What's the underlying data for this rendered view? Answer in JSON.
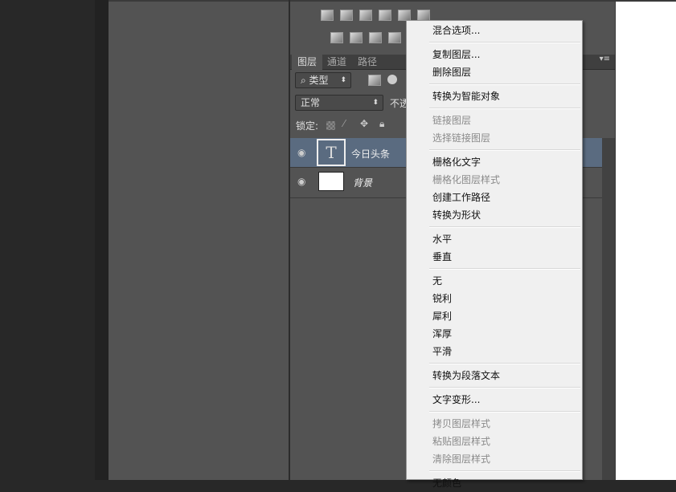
{
  "layers_panel": {
    "tabs": [
      "图层",
      "通道",
      "路径"
    ],
    "filter_kind": "类型",
    "blend_mode": "正常",
    "opacity_label": "不透",
    "lock_label": "锁定:",
    "layers": [
      {
        "name": "今日头条",
        "type": "text",
        "selected": true
      },
      {
        "name": "背景",
        "type": "background",
        "selected": false
      }
    ]
  },
  "context_menu": {
    "groups": [
      [
        {
          "label": "混合选项...",
          "enabled": true
        }
      ],
      [
        {
          "label": "复制图层...",
          "enabled": true
        },
        {
          "label": "删除图层",
          "enabled": true
        }
      ],
      [
        {
          "label": "转换为智能对象",
          "enabled": true
        }
      ],
      [
        {
          "label": "链接图层",
          "enabled": false
        },
        {
          "label": "选择链接图层",
          "enabled": false
        }
      ],
      [
        {
          "label": "栅格化文字",
          "enabled": true
        },
        {
          "label": "栅格化图层样式",
          "enabled": false
        },
        {
          "label": "创建工作路径",
          "enabled": true
        },
        {
          "label": "转换为形状",
          "enabled": true
        }
      ],
      [
        {
          "label": "水平",
          "enabled": true
        },
        {
          "label": "垂直",
          "enabled": true
        }
      ],
      [
        {
          "label": "无",
          "enabled": true
        },
        {
          "label": "锐利",
          "enabled": true
        },
        {
          "label": "犀利",
          "enabled": true
        },
        {
          "label": "浑厚",
          "enabled": true
        },
        {
          "label": "平滑",
          "enabled": true
        }
      ],
      [
        {
          "label": "转换为段落文本",
          "enabled": true
        }
      ],
      [
        {
          "label": "文字变形...",
          "enabled": true
        }
      ],
      [
        {
          "label": "拷贝图层样式",
          "enabled": false
        },
        {
          "label": "粘贴图层样式",
          "enabled": false
        },
        {
          "label": "清除图层样式",
          "enabled": false
        }
      ],
      [
        {
          "label": "无颜色",
          "enabled": true
        }
      ]
    ]
  }
}
